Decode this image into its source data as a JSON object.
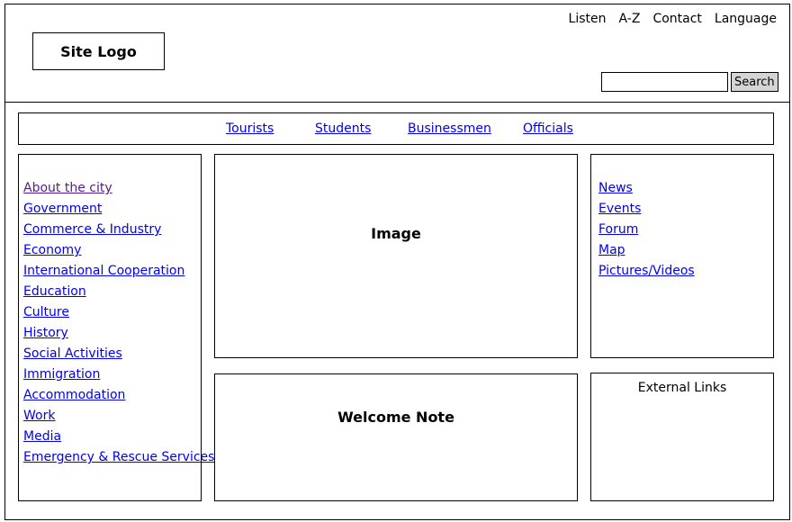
{
  "header": {
    "logo": "Site Logo",
    "utility_links": [
      "Listen",
      "A-Z",
      "Contact",
      "Language"
    ],
    "search": {
      "value": "",
      "placeholder": "",
      "button_label": "Search"
    }
  },
  "nav": {
    "items": [
      "Tourists",
      "Students",
      "Businessmen",
      "Officials"
    ]
  },
  "left_menu": {
    "items": [
      "About the city",
      "Government",
      "Commerce & Industry",
      "Economy",
      "International Cooperation",
      "Education",
      "Culture",
      "History",
      "Social Activities",
      "Immigration",
      "Accommodation",
      "Work",
      "Media",
      "Emergency & Rescue Services"
    ]
  },
  "main": {
    "image_placeholder": "Image",
    "welcome_placeholder": "Welcome Note"
  },
  "right_menu": {
    "items": [
      "News",
      "Events",
      "Forum",
      "Map",
      "Pictures/Videos"
    ]
  },
  "external_links": {
    "title": "External Links"
  },
  "colors": {
    "link": "#0000ee",
    "visited_link": "#551a8b",
    "border": "#000000",
    "button_bg": "#d4d4d4"
  }
}
